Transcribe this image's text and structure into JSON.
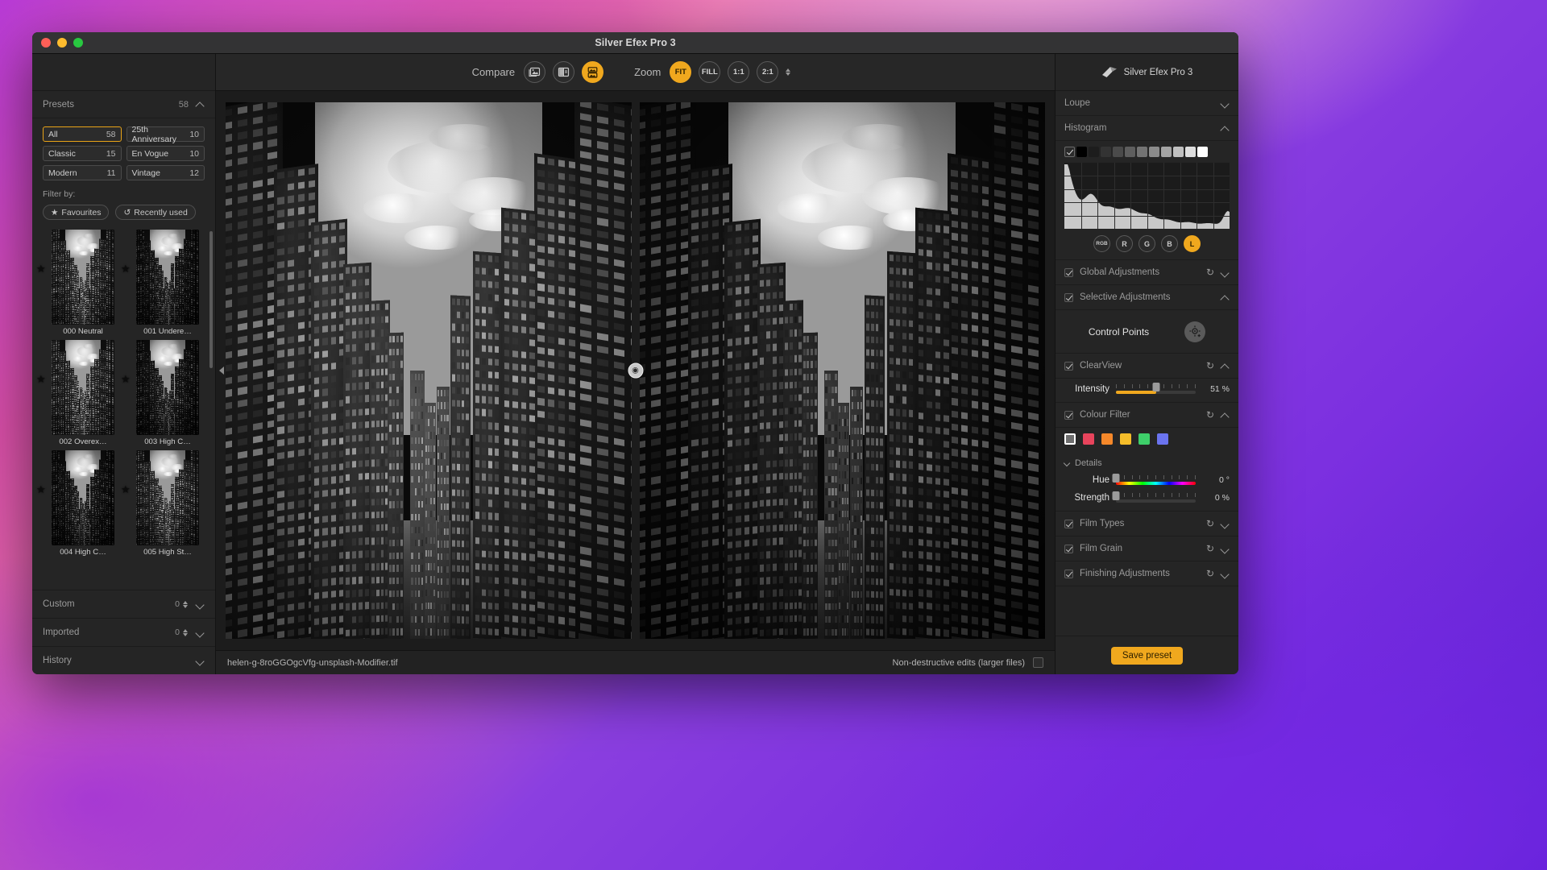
{
  "window": {
    "title": "Silver Efex Pro 3",
    "traffic_lights": [
      "close",
      "minimize",
      "zoom"
    ]
  },
  "sidebar": {
    "presets": {
      "label": "Presets",
      "count": "58",
      "categories": [
        {
          "name": "All",
          "count": "58",
          "active": true
        },
        {
          "name": "25th Anniversary",
          "count": "10",
          "active": false
        },
        {
          "name": "Classic",
          "count": "15",
          "active": false
        },
        {
          "name": "En Vogue",
          "count": "10",
          "active": false
        },
        {
          "name": "Modern",
          "count": "11",
          "active": false
        },
        {
          "name": "Vintage",
          "count": "12",
          "active": false
        }
      ],
      "filter_label": "Filter by:",
      "filters": [
        {
          "label": "Favourites",
          "icon": "star-icon"
        },
        {
          "label": "Recently used",
          "icon": "history-icon"
        }
      ],
      "thumbnails": [
        {
          "label": "000 Neutral",
          "favourite": true
        },
        {
          "label": "001 Undere…",
          "favourite": true
        },
        {
          "label": "002 Overex…",
          "favourite": true
        },
        {
          "label": "003 High C…",
          "favourite": true
        },
        {
          "label": "004 High C…",
          "favourite": true
        },
        {
          "label": "005 High St…",
          "favourite": true
        }
      ]
    },
    "sections": [
      {
        "label": "Custom",
        "count": "0",
        "has_stepper": true
      },
      {
        "label": "Imported",
        "count": "0",
        "has_stepper": true
      },
      {
        "label": "History",
        "count": "",
        "has_stepper": false
      }
    ]
  },
  "toolbar": {
    "compare_label": "Compare",
    "compare_buttons": [
      {
        "name": "single-image-view",
        "icon": "image-icon",
        "active": false
      },
      {
        "name": "split-view",
        "icon": "split-compare-icon",
        "active": false
      },
      {
        "name": "side-by-side-view",
        "icon": "side-by-side-icon",
        "active": true
      }
    ],
    "zoom_label": "Zoom",
    "zoom_buttons": [
      {
        "label": "FIT",
        "active": true
      },
      {
        "label": "FILL",
        "active": false
      },
      {
        "label": "1:1",
        "active": false
      },
      {
        "label": "2:1",
        "active": false
      }
    ]
  },
  "statusbar": {
    "filename": "helen-g-8roGGOgcVfg-unsplash-Modifier.tif",
    "nondestructive_label": "Non-destructive edits (larger files)"
  },
  "rightpanel": {
    "brand": "Silver Efex Pro 3",
    "loupe": {
      "label": "Loupe",
      "expanded": false
    },
    "histogram": {
      "label": "Histogram",
      "expanded": true,
      "zones_checked": true,
      "channels": [
        {
          "label": "RGB",
          "active": false
        },
        {
          "label": "R",
          "active": false
        },
        {
          "label": "G",
          "active": false
        },
        {
          "label": "B",
          "active": false
        },
        {
          "label": "L",
          "active": true
        }
      ]
    },
    "global_adjustments": {
      "label": "Global Adjustments",
      "checked": true,
      "expanded": false
    },
    "selective_adjustments": {
      "label": "Selective Adjustments",
      "checked": true,
      "expanded": true
    },
    "control_points": {
      "label": "Control Points",
      "button_icon": "add-control-point-icon"
    },
    "clearview": {
      "label": "ClearView",
      "checked": true,
      "expanded": true,
      "intensity_label": "Intensity",
      "intensity_value": "51 %",
      "intensity_percent": 51
    },
    "colour_filter": {
      "label": "Colour Filter",
      "checked": true,
      "expanded": true,
      "swatches": [
        {
          "name": "neutral",
          "color": "#6e6e6e",
          "selected": true
        },
        {
          "name": "red",
          "color": "#e8445c"
        },
        {
          "name": "orange",
          "color": "#f5882a"
        },
        {
          "name": "yellow",
          "color": "#f5bd2a"
        },
        {
          "name": "green",
          "color": "#3ecf6a"
        },
        {
          "name": "blue",
          "color": "#6b74ef"
        }
      ],
      "details_label": "Details",
      "hue_label": "Hue",
      "hue_value": "0 °",
      "hue_percent": 0,
      "strength_label": "Strength",
      "strength_value": "0 %",
      "strength_percent": 0
    },
    "film_types": {
      "label": "Film Types",
      "checked": true,
      "expanded": false
    },
    "film_grain": {
      "label": "Film Grain",
      "checked": true,
      "expanded": false
    },
    "finishing_adjustments": {
      "label": "Finishing Adjustments",
      "checked": true,
      "expanded": false
    },
    "save_preset_label": "Save preset"
  },
  "colors": {
    "accent": "#f0a81e",
    "panel_bg": "#252525",
    "window_bg": "#1e1e1e",
    "titlebar_bg": "#333334",
    "text": "#b9b9b9"
  }
}
